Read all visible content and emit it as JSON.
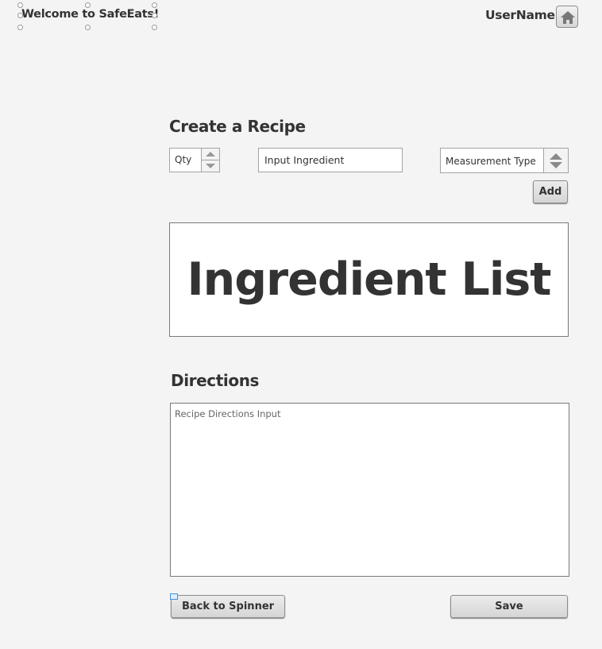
{
  "header": {
    "welcome_text": "Welcome to SafeEats!",
    "username": "UserName",
    "home_icon": "home-icon"
  },
  "recipe": {
    "heading": "Create a Recipe",
    "qty_value": "Qty",
    "ingredient_placeholder": "Input Ingredient",
    "measurement_value": "Measurement Type",
    "add_label": "Add",
    "ingredient_list_label": "Ingredient List"
  },
  "directions": {
    "heading": "Directions",
    "placeholder": "Recipe Directions Input"
  },
  "footer": {
    "back_label": "Back to Spinner",
    "save_label": "Save"
  },
  "colors": {
    "background": "#f4f4f4",
    "text": "#333333",
    "border": "#a3a3a3"
  }
}
